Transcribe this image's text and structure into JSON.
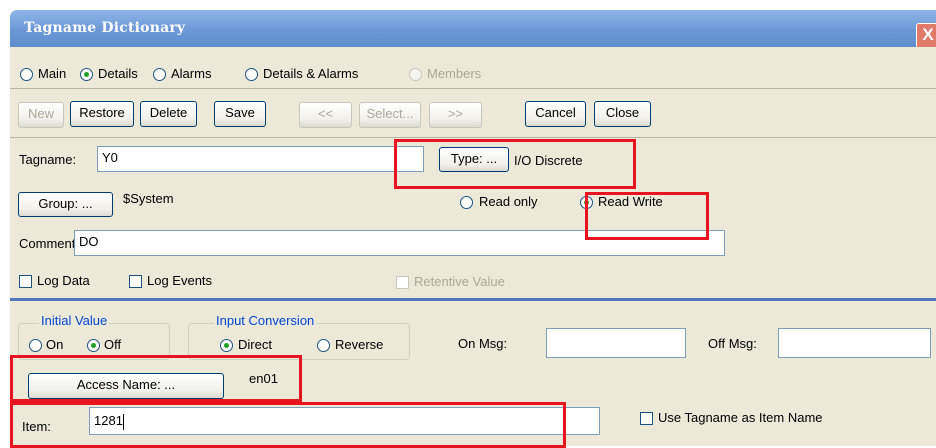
{
  "window": {
    "title": "Tagname Dictionary",
    "close_glyph": "X"
  },
  "tabs": [
    {
      "label": "Main",
      "selected": false,
      "enabled": true
    },
    {
      "label": "Details",
      "selected": true,
      "enabled": true
    },
    {
      "label": "Alarms",
      "selected": false,
      "enabled": true
    },
    {
      "label": "Details & Alarms",
      "selected": false,
      "enabled": true
    },
    {
      "label": "Members",
      "selected": false,
      "enabled": false
    }
  ],
  "toolbar": {
    "new": "New",
    "restore": "Restore",
    "delete": "Delete",
    "save": "Save",
    "prev": "<<",
    "select": "Select...",
    "next": ">>",
    "cancel": "Cancel",
    "close": "Close"
  },
  "form": {
    "tagname_label": "Tagname:",
    "tagname_value": "Y0",
    "type_button": "Type: ...",
    "type_value": "I/O Discrete",
    "group_button": "Group: ...",
    "group_value": "$System",
    "read_only": "Read only",
    "read_write": "Read Write",
    "comment_label": "Comment:",
    "comment_value": "DO",
    "log_data": "Log Data",
    "log_events": "Log Events",
    "retentive": "Retentive Value"
  },
  "io": {
    "initial_value_legend": "Initial Value",
    "on": "On",
    "off": "Off",
    "input_conversion_legend": "Input Conversion",
    "direct": "Direct",
    "reverse": "Reverse",
    "on_msg_label": "On Msg:",
    "on_msg_value": "",
    "off_msg_label": "Off Msg:",
    "off_msg_value": "",
    "access_name_button": "Access Name: ...",
    "access_name_value": "en01",
    "item_label": "Item:",
    "item_value": "1281",
    "use_tagname": "Use Tagname as Item Name"
  },
  "colors": {
    "annotation": "#e8141f",
    "titlebar": "#6b97d6",
    "panel": "#ece9d8"
  }
}
